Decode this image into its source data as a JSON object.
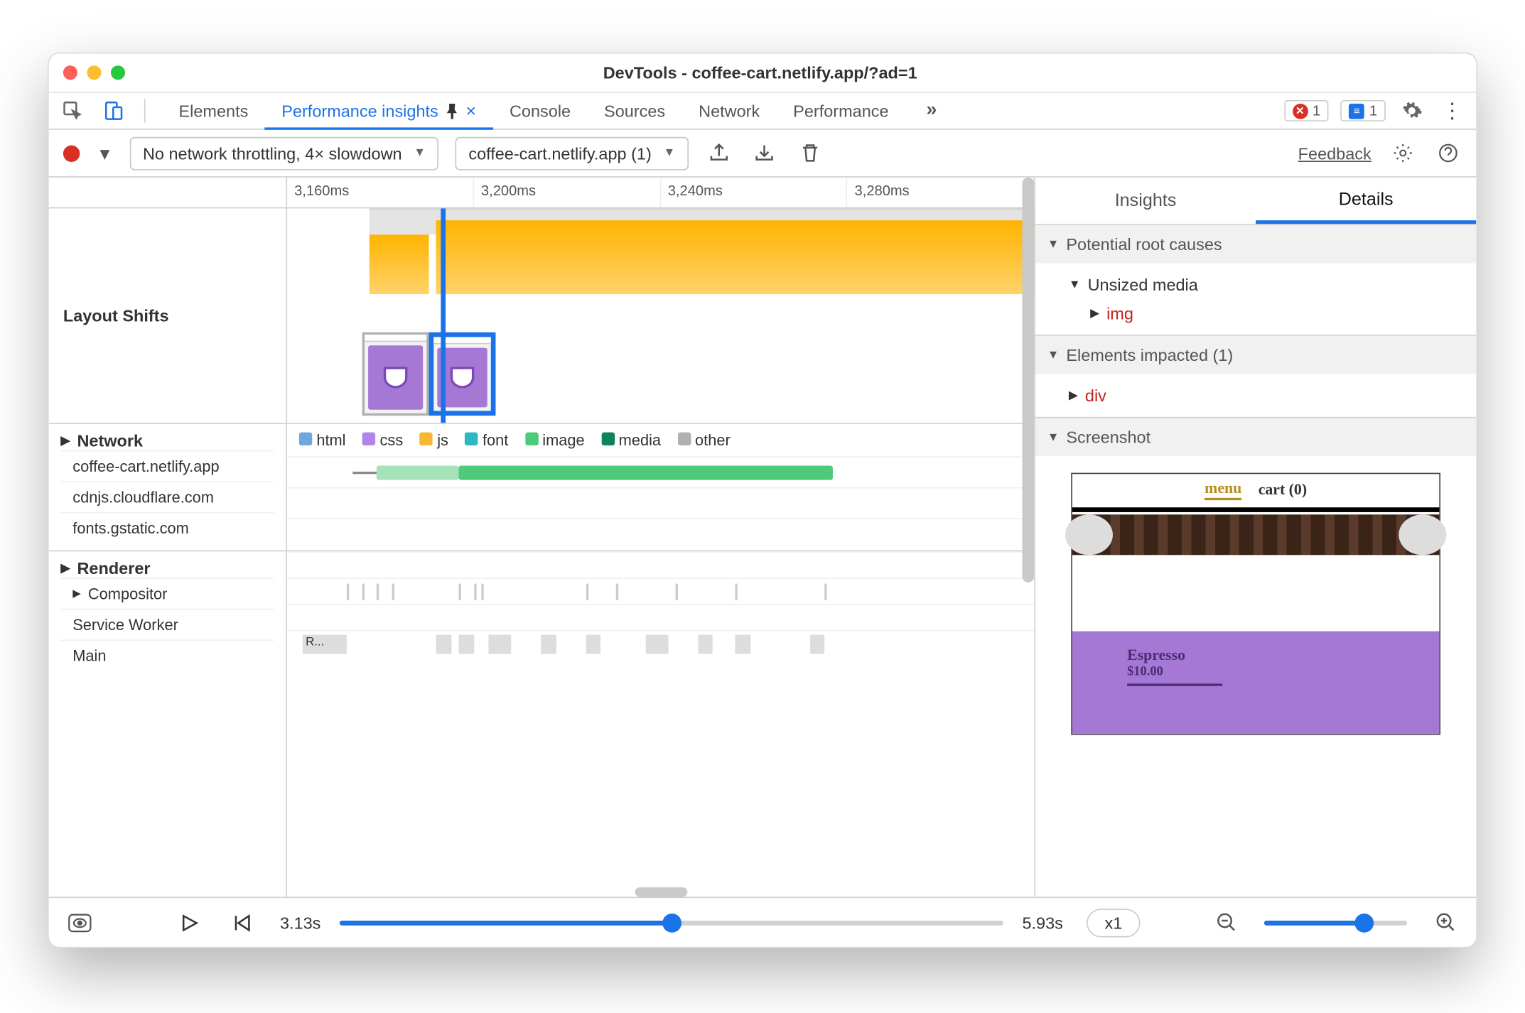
{
  "title": "DevTools - coffee-cart.netlify.app/?ad=1",
  "tabs": {
    "items": [
      "Elements",
      "Performance insights",
      "Console",
      "Sources",
      "Network",
      "Performance"
    ],
    "activeIndex": 1
  },
  "error_badge": "1",
  "message_badge": "1",
  "toolbar": {
    "throttling": "No network throttling, 4× slowdown",
    "recording": "coffee-cart.netlify.app (1)",
    "feedback": "Feedback"
  },
  "ruler": [
    "3,160ms",
    "3,200ms",
    "3,240ms",
    "3,280ms"
  ],
  "timeline": {
    "layoutShifts": "Layout Shifts",
    "network": "Network",
    "legend": [
      "html",
      "css",
      "js",
      "font",
      "image",
      "media",
      "other"
    ],
    "hosts": [
      "coffee-cart.netlify.app",
      "cdnjs.cloudflare.com",
      "fonts.gstatic.com"
    ],
    "renderer": "Renderer",
    "rendererRows": [
      "Compositor",
      "Service Worker",
      "Main"
    ],
    "flameLabel": "R..."
  },
  "details": {
    "tabs": [
      "Insights",
      "Details"
    ],
    "activeIndex": 1,
    "sections": {
      "rootCauses": "Potential root causes",
      "unsized": "Unsized media",
      "unsizedItem": "img",
      "impacted": "Elements impacted (1)",
      "impactedItem": "div",
      "screenshot": "Screenshot"
    },
    "shot": {
      "menu": "menu",
      "cart": "cart (0)",
      "product": "Espresso",
      "price": "$10.00"
    }
  },
  "bottom": {
    "start": "3.13s",
    "end": "5.93s",
    "speed": "x1"
  }
}
